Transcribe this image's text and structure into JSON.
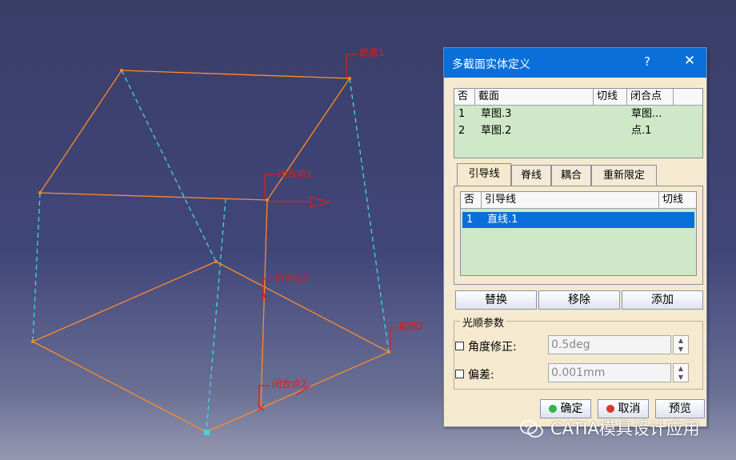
{
  "viewport_labels": {
    "section1": "截面1",
    "section2": "截面2",
    "closing_point1": "闭合点1",
    "closing_point2": "闭合点2",
    "guide1": "引导线1"
  },
  "dialog": {
    "title": "多截面实体定义",
    "help": "?",
    "close": "✕",
    "sections_table": {
      "headers": [
        "否",
        "截面",
        "切线",
        "闭合点"
      ],
      "rows": [
        {
          "no": "1",
          "section": "草图.3",
          "tangent": "",
          "closing": "草图..."
        },
        {
          "no": "2",
          "section": "草图.2",
          "tangent": "",
          "closing": "点.1"
        }
      ]
    },
    "tabs": [
      "引导线",
      "脊线",
      "耦合",
      "重新限定"
    ],
    "guides_table": {
      "headers": [
        "否",
        "引导线",
        "切线"
      ],
      "rows": [
        {
          "no": "1",
          "guide": "直线.1",
          "tangent": ""
        }
      ]
    },
    "buttons": {
      "replace": "替换",
      "remove": "移除",
      "add": "添加"
    },
    "smoothing": {
      "title": "光顺参数",
      "angle_label": "角度修正:",
      "angle_value": "0.5deg",
      "deviation_label": "偏差:",
      "deviation_value": "0.001mm"
    },
    "footer": {
      "ok": "确定",
      "cancel": "取消",
      "preview": "预览"
    }
  },
  "watermark": "CATIA模具设计应用",
  "colors": {
    "wire_orange": "#ff8c28",
    "wire_cyan": "#3fd6e0",
    "label_red": "#d42020",
    "title_blue": "#0a6fd8"
  }
}
